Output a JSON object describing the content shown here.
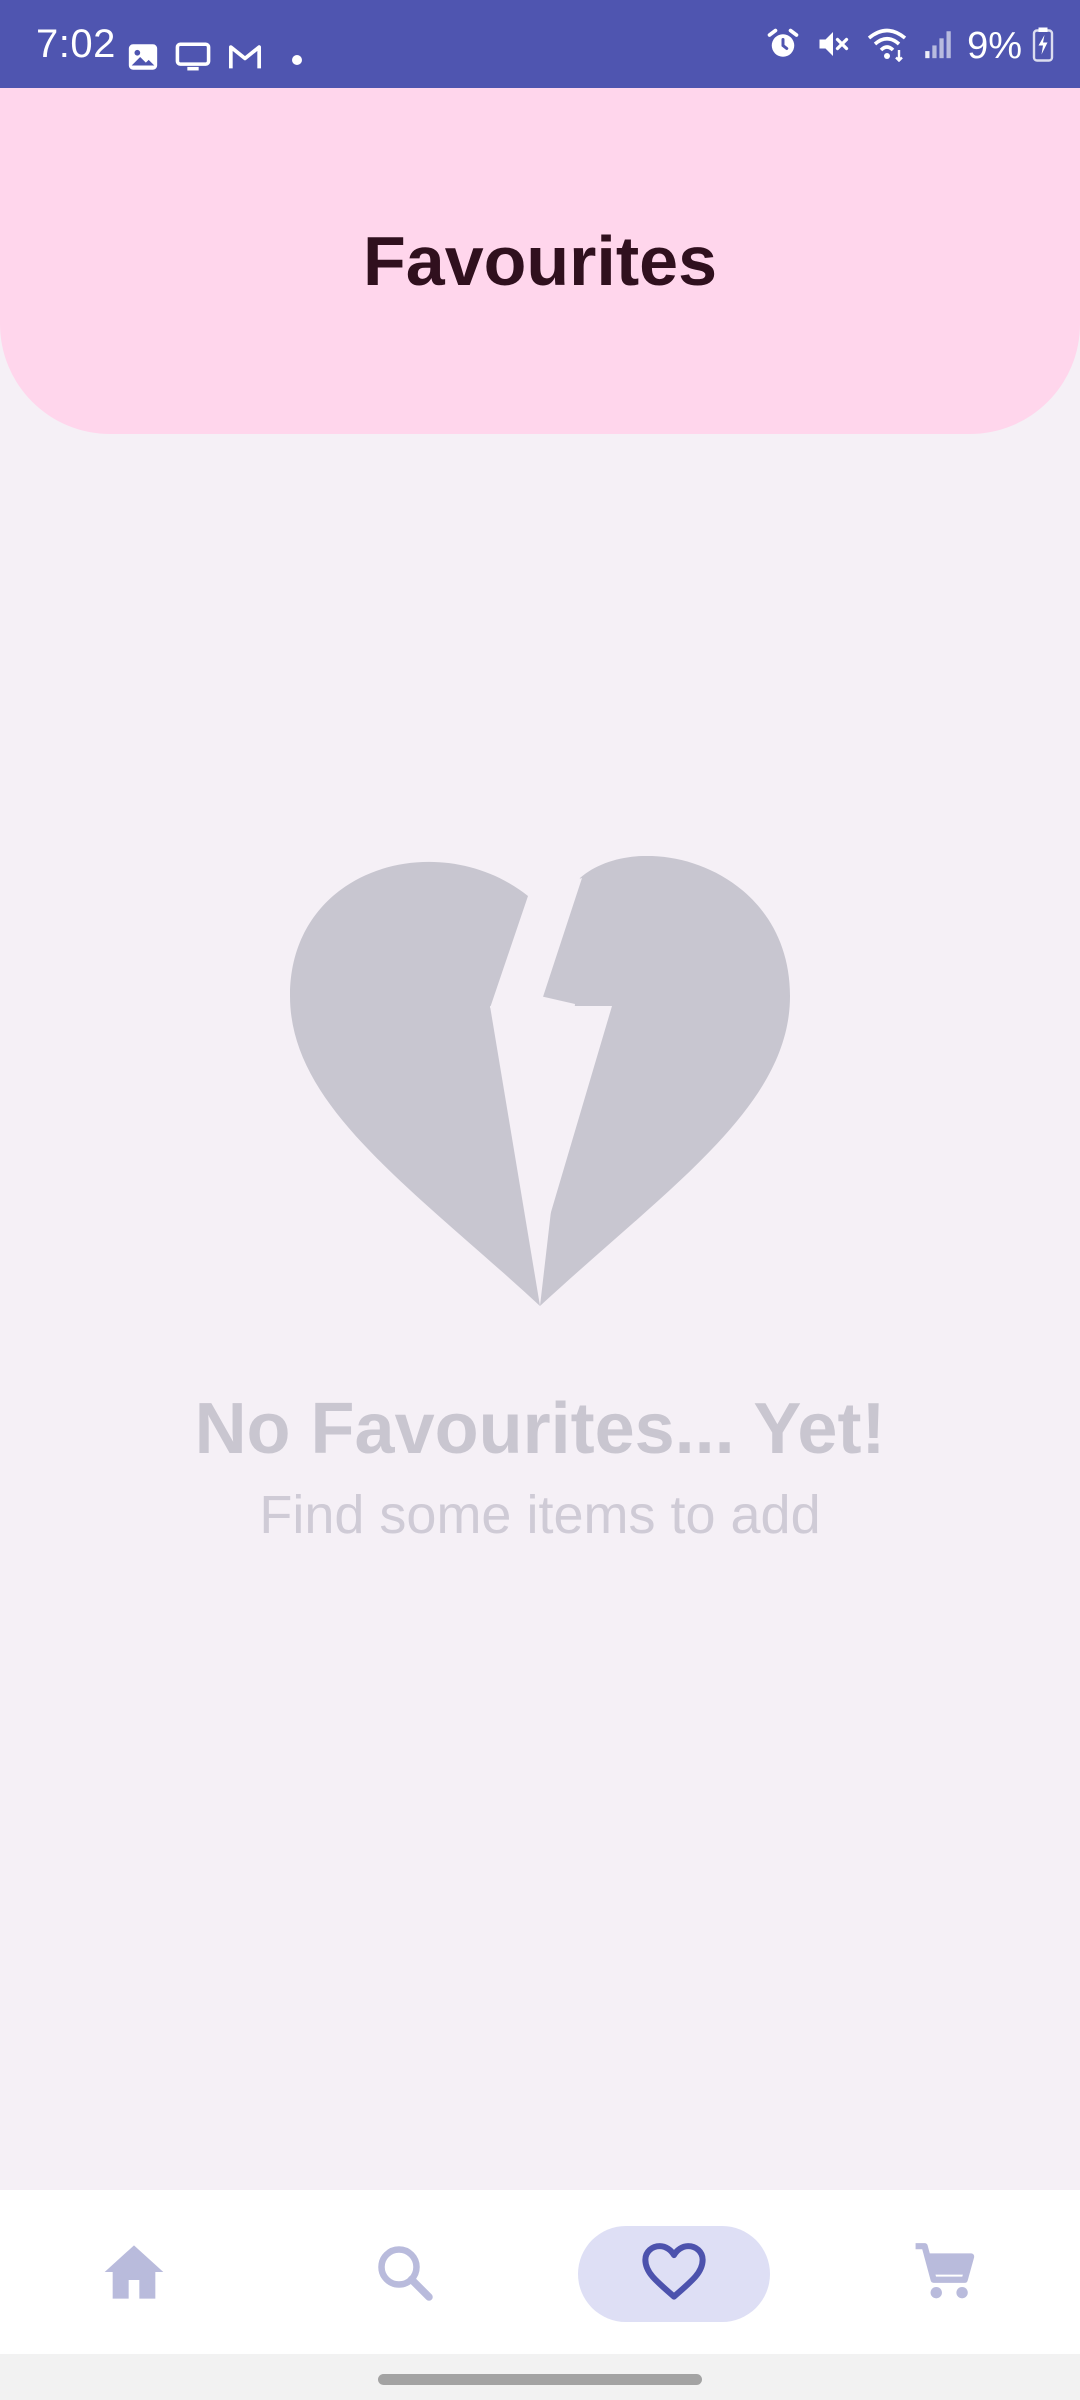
{
  "status_bar": {
    "time": "7:02",
    "battery_percent": "9%",
    "left_icons": [
      "gallery-icon",
      "screen-icon",
      "gmail-icon",
      "notification-dot"
    ],
    "right_icons": [
      "alarm-icon",
      "mute-icon",
      "wifi-icon",
      "signal-icon",
      "battery-icon"
    ]
  },
  "header": {
    "title": "Favourites"
  },
  "empty_state": {
    "icon": "broken-heart-icon",
    "title": "No Favourites... Yet!",
    "subtitle": "Find some items to add"
  },
  "bottom_nav": {
    "items": [
      {
        "icon": "home-icon",
        "selected": false
      },
      {
        "icon": "search-icon",
        "selected": false
      },
      {
        "icon": "heart-icon",
        "selected": true
      },
      {
        "icon": "cart-icon",
        "selected": false
      }
    ]
  },
  "colors": {
    "status_bar": "#4f55b0",
    "header_bg": "#ffd6ec",
    "page_bg": "#f5f0f6",
    "title_text": "#30101e",
    "empty_icon": "#c8c6d0",
    "nav_active_pill": "#dedff5",
    "nav_active_icon": "#4c52ad",
    "nav_inactive_icon": "#b9bbdc"
  }
}
